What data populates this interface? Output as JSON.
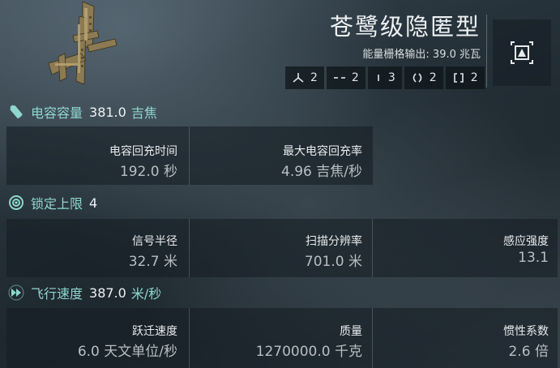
{
  "header": {
    "ship_name": "苍鹭级隐匿型",
    "power_grid": "能量栅格输出: 39.0 兆瓦"
  },
  "slots": [
    {
      "icon": "high-slot-icon",
      "count": "2"
    },
    {
      "icon": "turret-hardpoint-icon",
      "count": "2"
    },
    {
      "icon": "launcher-hardpoint-icon",
      "count": "3"
    },
    {
      "icon": "mid-slot-icon",
      "count": "2"
    },
    {
      "icon": "low-slot-icon",
      "count": "2"
    }
  ],
  "capacitor": {
    "label": "电容容量",
    "value": "381.0",
    "unit": "吉焦",
    "recharge_time_label": "电容回充时间",
    "recharge_time_value": "192.0 秒",
    "peak_recharge_label": "最大电容回充率",
    "peak_recharge_value": "4.96 吉焦/秒"
  },
  "targeting": {
    "label": "锁定上限",
    "value": "4",
    "signature_label": "信号半径",
    "signature_value": "32.7 米",
    "scan_res_label": "扫描分辨率",
    "scan_res_value": "701.0 米",
    "sensor_label": "感应强度",
    "sensor_value": "13.1"
  },
  "navigation": {
    "label": "飞行速度",
    "value": "387.0",
    "unit": "米/秒",
    "warp_label": "跃迁速度",
    "warp_value": "6.0 天文单位/秒",
    "mass_label": "质量",
    "mass_value": "1270000.0 千克",
    "inertia_label": "惯性系数",
    "inertia_value": "2.6 倍"
  },
  "colors": {
    "accent": "#8fd6cf",
    "text": "#eef2f4",
    "muted": "#b7bfc4"
  }
}
